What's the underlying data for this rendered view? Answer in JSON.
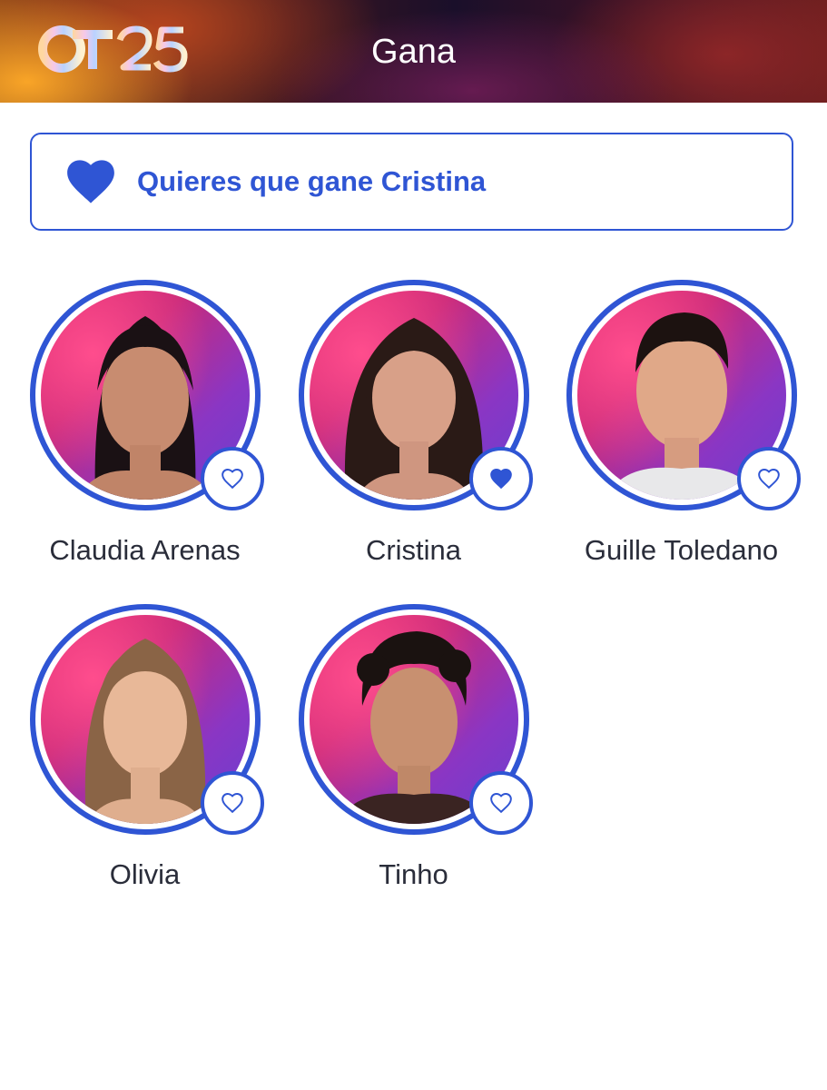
{
  "header": {
    "logo_text": "OT25",
    "title": "Gana"
  },
  "vote_banner": {
    "text": "Quieres que gane Cristina",
    "icon": "heart-filled-icon"
  },
  "colors": {
    "accent": "#2f55d4",
    "name_text": "#2a2d3a"
  },
  "contestants": [
    {
      "name": "Claudia Arenas",
      "favorite": false,
      "icon": "heart-outline-icon"
    },
    {
      "name": "Cristina",
      "favorite": true,
      "icon": "heart-filled-icon"
    },
    {
      "name": "Guille Toledano",
      "favorite": false,
      "icon": "heart-outline-icon"
    },
    {
      "name": "Olivia",
      "favorite": false,
      "icon": "heart-outline-icon"
    },
    {
      "name": "Tinho",
      "favorite": false,
      "icon": "heart-outline-icon"
    }
  ]
}
